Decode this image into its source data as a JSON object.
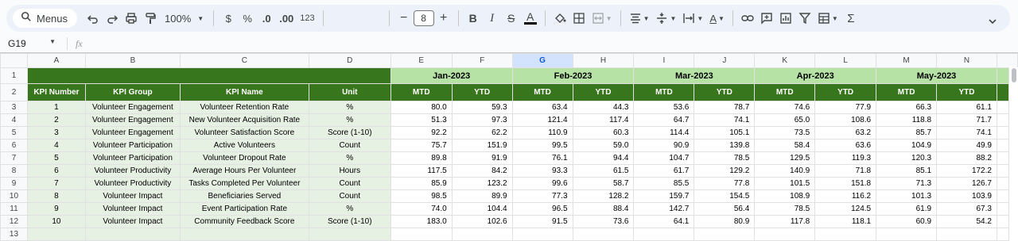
{
  "toolbar": {
    "menus_label": "Menus",
    "zoom": "100%",
    "currency": "$",
    "percent": "%",
    "dec_decrease": ".0",
    "dec_increase": ".00",
    "number_format": "123",
    "font_size": "8",
    "bold": "B",
    "italic": "I",
    "strike": "S",
    "text_color": "A",
    "text_rotate": "A"
  },
  "formula_bar": {
    "cell_ref": "G19",
    "fx": "fx"
  },
  "columns": [
    "A",
    "B",
    "C",
    "D",
    "E",
    "F",
    "G",
    "H",
    "I",
    "J",
    "K",
    "L",
    "M",
    "N"
  ],
  "selected_column": "G",
  "rows": [
    "1",
    "2",
    "3",
    "4",
    "5",
    "6",
    "7",
    "8",
    "9",
    "10",
    "11",
    "12",
    "13"
  ],
  "months": [
    "Jan-2023",
    "Feb-2023",
    "Mar-2023",
    "Apr-2023",
    "May-2023"
  ],
  "headers": {
    "kpi_number": "KPI Number",
    "kpi_group": "KPI Group",
    "kpi_name": "KPI Name",
    "unit": "Unit",
    "mtd": "MTD",
    "ytd": "YTD"
  },
  "kpis": [
    {
      "num": "1",
      "group": "Volunteer Engagement",
      "name": "Volunteer Retention Rate",
      "unit": "%",
      "vals": [
        "80.0",
        "59.3",
        "63.4",
        "44.3",
        "53.6",
        "78.7",
        "74.6",
        "77.9",
        "66.3",
        "61.1"
      ]
    },
    {
      "num": "2",
      "group": "Volunteer Engagement",
      "name": "New Volunteer Acquisition Rate",
      "unit": "%",
      "vals": [
        "51.3",
        "97.3",
        "121.4",
        "117.4",
        "64.7",
        "74.1",
        "65.0",
        "108.6",
        "118.8",
        "71.7"
      ]
    },
    {
      "num": "3",
      "group": "Volunteer Engagement",
      "name": "Volunteer Satisfaction Score",
      "unit": "Score (1-10)",
      "vals": [
        "92.2",
        "62.2",
        "110.9",
        "60.3",
        "114.4",
        "105.1",
        "73.5",
        "63.2",
        "85.7",
        "74.1"
      ]
    },
    {
      "num": "4",
      "group": "Volunteer Participation",
      "name": "Active Volunteers",
      "unit": "Count",
      "vals": [
        "75.7",
        "151.9",
        "99.5",
        "59.0",
        "90.9",
        "139.8",
        "58.4",
        "63.6",
        "104.9",
        "49.9"
      ]
    },
    {
      "num": "5",
      "group": "Volunteer Participation",
      "name": "Volunteer Dropout Rate",
      "unit": "%",
      "vals": [
        "89.8",
        "91.9",
        "76.1",
        "94.4",
        "104.7",
        "78.5",
        "129.5",
        "119.3",
        "120.3",
        "88.2"
      ]
    },
    {
      "num": "6",
      "group": "Volunteer Productivity",
      "name": "Average Hours Per Volunteer",
      "unit": "Hours",
      "vals": [
        "117.5",
        "84.2",
        "93.3",
        "61.5",
        "61.7",
        "129.2",
        "140.9",
        "71.8",
        "85.1",
        "172.2"
      ]
    },
    {
      "num": "7",
      "group": "Volunteer Productivity",
      "name": "Tasks Completed Per Volunteer",
      "unit": "Count",
      "vals": [
        "85.9",
        "123.2",
        "99.6",
        "58.7",
        "85.5",
        "77.8",
        "101.5",
        "151.8",
        "71.3",
        "126.7"
      ]
    },
    {
      "num": "8",
      "group": "Volunteer Impact",
      "name": "Beneficiaries Served",
      "unit": "Count",
      "vals": [
        "98.5",
        "89.9",
        "77.3",
        "128.2",
        "159.7",
        "154.5",
        "108.9",
        "116.2",
        "101.3",
        "103.9"
      ]
    },
    {
      "num": "9",
      "group": "Volunteer Impact",
      "name": "Event Participation Rate",
      "unit": "%",
      "vals": [
        "74.0",
        "104.4",
        "96.5",
        "88.4",
        "142.7",
        "56.4",
        "78.5",
        "124.5",
        "61.9",
        "67.3"
      ]
    },
    {
      "num": "10",
      "group": "Volunteer Impact",
      "name": "Community Feedback Score",
      "unit": "Score (1-10)",
      "vals": [
        "183.0",
        "102.6",
        "91.5",
        "73.6",
        "64.1",
        "80.9",
        "117.8",
        "118.1",
        "60.9",
        "54.2"
      ]
    }
  ]
}
